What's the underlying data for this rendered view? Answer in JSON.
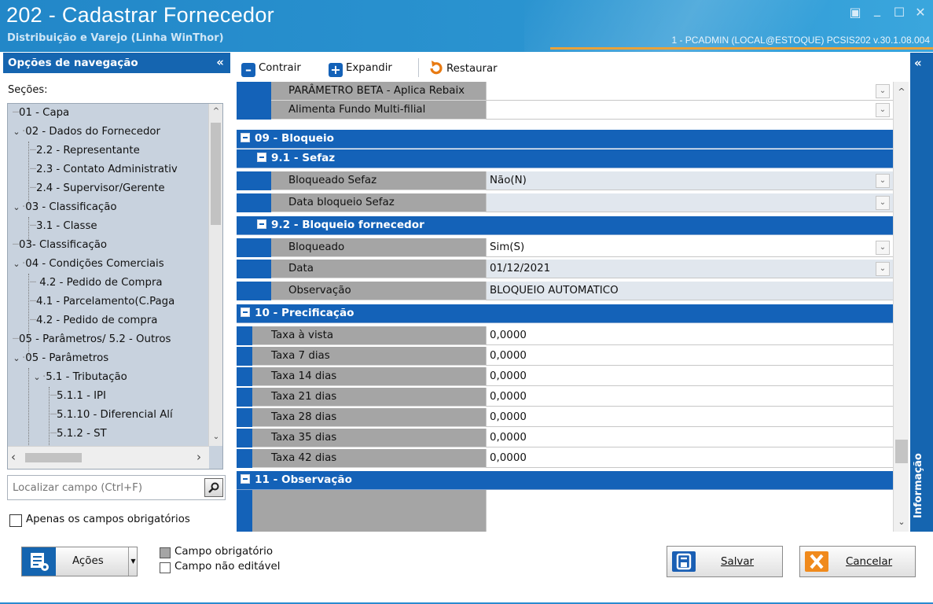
{
  "window": {
    "title": "202 - Cadastrar  Fornecedor",
    "subtitle": "Distribuição e Varejo (Linha WinThor)",
    "status": "1 - PCADMIN (LOCAL@ESTOQUE)   PCSIS202  v.30.1.08.004",
    "controls": [
      "▣",
      "_",
      "☐",
      "✕"
    ]
  },
  "nav": {
    "header": "Opções de navegação",
    "collapse": "«",
    "sections_label": "Seções:",
    "tree": [
      "01 - Capa",
      "02 - Dados do Fornecedor",
      "2.2 - Representante",
      "2.3 - Contato Administrativ",
      "2.4 - Supervisor/Gerente",
      "03 - Classificação",
      "3.1 - Classe",
      "03- Classificação",
      "04 - Condições Comerciais",
      "4.2 - Pedido de Compra",
      "4.1 - Parcelamento(C.Paga",
      "4.2 - Pedido de compra",
      "05 - Parâmetros/ 5.2 - Outros",
      "05 - Parâmetros",
      "5.1 - Tributação",
      "5.1.1 - IPI",
      "5.1.10 - Diferencial Alí",
      "5.1.2 - ST"
    ],
    "search_placeholder": "Localizar campo (Ctrl+F)",
    "required_only": "Apenas os campos obrigatórios"
  },
  "toolbar": {
    "collapse": "Contrair",
    "expand": "Expandir",
    "restore": "Restaurar"
  },
  "grid": {
    "rows": [
      {
        "label": "PARÂMETRO BETA - Aplica Rebaix",
        "value": ""
      },
      {
        "label": "Alimenta Fundo Multi-filial",
        "value": ""
      },
      {
        "group": "09 - Bloqueio"
      },
      {
        "group": "9.1 - Sefaz"
      },
      {
        "label": "Bloqueado Sefaz",
        "value": "Não(N)"
      },
      {
        "label": "Data bloqueio Sefaz",
        "value": ""
      },
      {
        "group": "9.2 - Bloqueio fornecedor"
      },
      {
        "label": "Bloqueado",
        "value": "Sim(S)"
      },
      {
        "label": "Data",
        "value": "01/12/2021"
      },
      {
        "label": "Observação",
        "value": "BLOQUEIO AUTOMATICO"
      },
      {
        "group": "10 - Precificação"
      },
      {
        "label": "Taxa à vista",
        "value": "0,0000"
      },
      {
        "label": "Taxa 7 dias",
        "value": "0,0000"
      },
      {
        "label": "Taxa 14 dias",
        "value": "0,0000"
      },
      {
        "label": "Taxa 21 dias",
        "value": "0,0000"
      },
      {
        "label": "Taxa 28 dias",
        "value": "0,0000"
      },
      {
        "label": "Taxa 35 dias",
        "value": "0,0000"
      },
      {
        "label": "Taxa 42 dias",
        "value": "0,0000"
      },
      {
        "group": "11 - Observação"
      }
    ]
  },
  "info_panel": {
    "label": "Informação",
    "collapse": "«"
  },
  "footer": {
    "actions": "Ações",
    "legend_required": "Campo obrigatório",
    "legend_readonly": "Campo não editável",
    "save": "Salvar",
    "cancel": "Cancelar"
  },
  "colors": {
    "accent": "#1565b0",
    "title_bar": "#2287c8",
    "label_cell": "#a5a5a5",
    "non_editable": "#e1e7ee",
    "required": "#a5a5a5",
    "save_icon": "#1a5fb4",
    "cancel_icon": "#f08a1c"
  }
}
